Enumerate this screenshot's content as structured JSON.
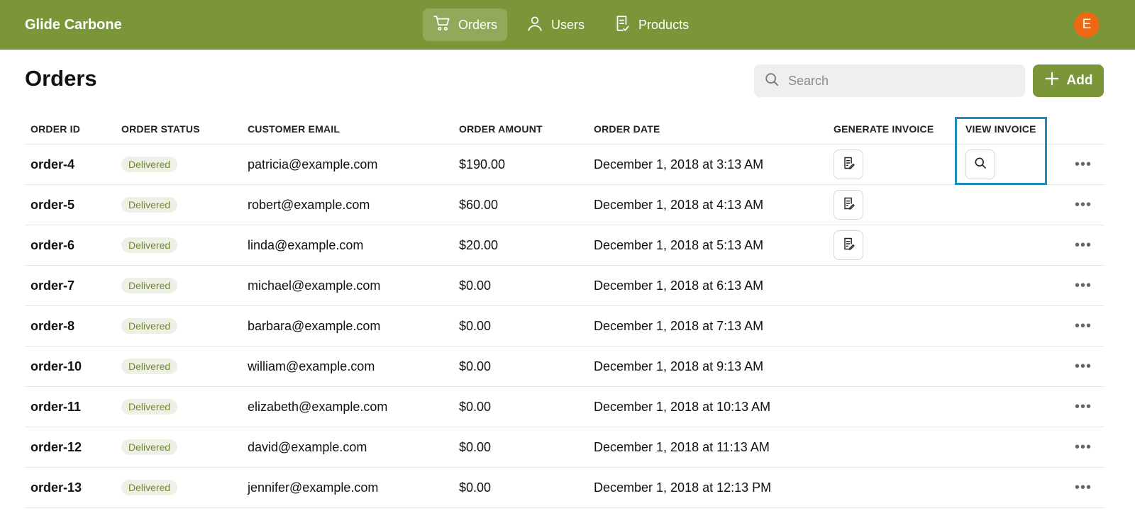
{
  "app": {
    "brand": "Glide Carbone",
    "avatar_initial": "E"
  },
  "nav": [
    {
      "label": "Orders",
      "icon": "cart-icon",
      "active": true
    },
    {
      "label": "Users",
      "icon": "user-icon",
      "active": false
    },
    {
      "label": "Products",
      "icon": "document-icon",
      "active": false
    }
  ],
  "page": {
    "title": "Orders"
  },
  "search": {
    "placeholder": "Search",
    "value": ""
  },
  "add_button": {
    "label": "Add"
  },
  "table": {
    "headers": [
      "ORDER ID",
      "ORDER STATUS",
      "CUSTOMER EMAIL",
      "ORDER AMOUNT",
      "ORDER DATE",
      "GENERATE INVOICE",
      "VIEW INVOICE"
    ],
    "rows": [
      {
        "id": "order-4",
        "status": "Delivered",
        "email": "patricia@example.com",
        "amount": "$190.00",
        "date": "December 1, 2018 at 3:13 AM",
        "generate_invoice": true,
        "view_invoice": true
      },
      {
        "id": "order-5",
        "status": "Delivered",
        "email": "robert@example.com",
        "amount": "$60.00",
        "date": "December 1, 2018 at 4:13 AM",
        "generate_invoice": true,
        "view_invoice": false
      },
      {
        "id": "order-6",
        "status": "Delivered",
        "email": "linda@example.com",
        "amount": "$20.00",
        "date": "December 1, 2018 at 5:13 AM",
        "generate_invoice": true,
        "view_invoice": false
      },
      {
        "id": "order-7",
        "status": "Delivered",
        "email": "michael@example.com",
        "amount": "$0.00",
        "date": "December 1, 2018 at 6:13 AM",
        "generate_invoice": false,
        "view_invoice": false
      },
      {
        "id": "order-8",
        "status": "Delivered",
        "email": "barbara@example.com",
        "amount": "$0.00",
        "date": "December 1, 2018 at 7:13 AM",
        "generate_invoice": false,
        "view_invoice": false
      },
      {
        "id": "order-10",
        "status": "Delivered",
        "email": "william@example.com",
        "amount": "$0.00",
        "date": "December 1, 2018 at 9:13 AM",
        "generate_invoice": false,
        "view_invoice": false
      },
      {
        "id": "order-11",
        "status": "Delivered",
        "email": "elizabeth@example.com",
        "amount": "$0.00",
        "date": "December 1, 2018 at 10:13 AM",
        "generate_invoice": false,
        "view_invoice": false
      },
      {
        "id": "order-12",
        "status": "Delivered",
        "email": "david@example.com",
        "amount": "$0.00",
        "date": "December 1, 2018 at 11:13 AM",
        "generate_invoice": false,
        "view_invoice": false
      },
      {
        "id": "order-13",
        "status": "Delivered",
        "email": "jennifer@example.com",
        "amount": "$0.00",
        "date": "December 1, 2018 at 12:13 PM",
        "generate_invoice": false,
        "view_invoice": false
      }
    ]
  },
  "colors": {
    "brand": "#7a9639",
    "avatar": "#ec6a14",
    "badge_text": "#6f8a34",
    "highlight": "#1f8bbd"
  }
}
